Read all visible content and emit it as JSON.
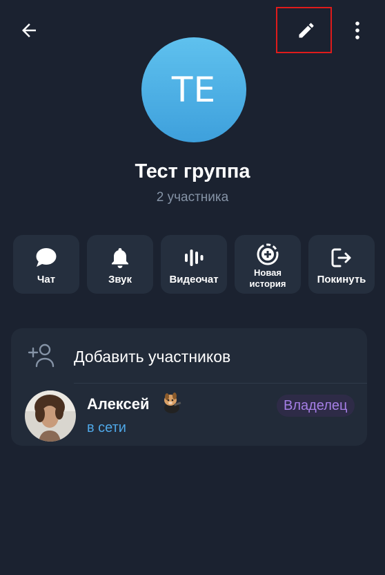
{
  "header": {
    "back_icon": "arrow-left-icon",
    "edit_icon": "pencil-icon",
    "more_icon": "more-vertical-icon"
  },
  "group": {
    "avatar_initials": "TE",
    "avatar_color": "#4fb1e6",
    "title": "Тест группа",
    "subtitle": "2 участника"
  },
  "actions": [
    {
      "label": "Чат",
      "icon": "chat-bubble-icon"
    },
    {
      "label": "Звук",
      "icon": "bell-icon"
    },
    {
      "label": "Видеочат",
      "icon": "voice-wave-icon"
    },
    {
      "label": "Новая история",
      "icon": "add-story-icon"
    },
    {
      "label": "Покинуть",
      "icon": "leave-icon"
    }
  ],
  "members": {
    "add_label": "Добавить участников",
    "add_icon": "add-user-icon",
    "list": [
      {
        "name": "Алексей",
        "status": "в сети",
        "role": "Владелец",
        "emoji_status": "dog-emoji-status"
      }
    ]
  },
  "colors": {
    "background": "#1b2230",
    "card": "#222b39",
    "status_online": "#4fa8e8",
    "role_badge_text": "#a57fe6",
    "highlight": "#e01b1b"
  }
}
